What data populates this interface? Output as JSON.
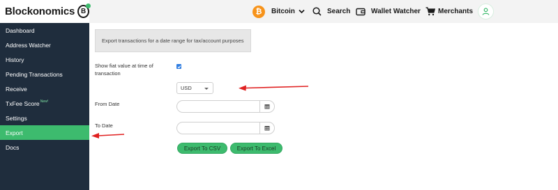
{
  "brand": {
    "name": "Blockonomics",
    "badge_letter": "B",
    "accent": "#3dbb6e"
  },
  "header": {
    "currency": {
      "symbol": "₿",
      "label": "Bitcoin"
    },
    "search_label": "Search",
    "wallet_watcher_label": "Wallet Watcher",
    "merchants_label": "Merchants"
  },
  "sidebar": {
    "items": [
      {
        "label": "Dashboard"
      },
      {
        "label": "Address Watcher"
      },
      {
        "label": "History"
      },
      {
        "label": "Pending Transactions"
      },
      {
        "label": "Receive"
      },
      {
        "label": "TxFee Score",
        "badge": "New!"
      },
      {
        "label": "Settings"
      },
      {
        "label": "Export",
        "active": true
      },
      {
        "label": "Docs"
      }
    ]
  },
  "main": {
    "info_text": "Export transactions for a date range for tax/account purposes",
    "fiat_label": "Show fiat value at time of transaction",
    "fiat_checked": true,
    "currency_select_value": "USD",
    "from_date_label": "From Date",
    "to_date_label": "To Date",
    "from_date_value": "",
    "to_date_value": "",
    "export_csv_label": "Export To CSV",
    "export_excel_label": "Export To Excel"
  }
}
